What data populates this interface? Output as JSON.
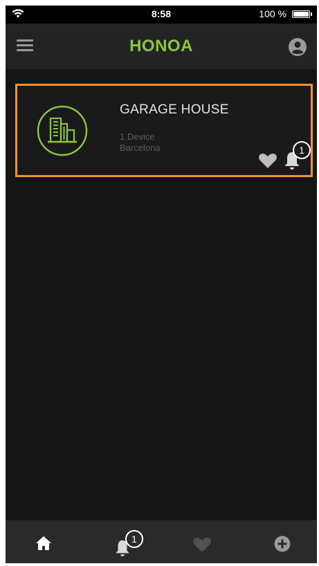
{
  "status_bar": {
    "time": "8:58",
    "battery_percent": "100 %",
    "wifi_icon": "wifi-icon",
    "battery_icon": "battery-icon"
  },
  "header": {
    "title": "HONOA",
    "menu_icon": "hamburger-menu-icon",
    "profile_icon": "user-profile-icon"
  },
  "homes": [
    {
      "name": "GARAGE HOUSE",
      "devices": "1 Device",
      "location": "Barcelona",
      "icon": "buildings-icon",
      "notification_count": "1",
      "selected": true
    }
  ],
  "bottom_nav": {
    "items": [
      {
        "icon": "home-icon",
        "active": true
      },
      {
        "icon": "bell-icon",
        "badge": "1"
      },
      {
        "icon": "heart-icon"
      },
      {
        "icon": "plus-circle-icon"
      }
    ]
  },
  "colors": {
    "brand_green": "#8dc63f",
    "selection_orange": "#f0962a",
    "background": "#161616",
    "header_bg": "#232323",
    "nav_bg": "#2a2a2a"
  }
}
